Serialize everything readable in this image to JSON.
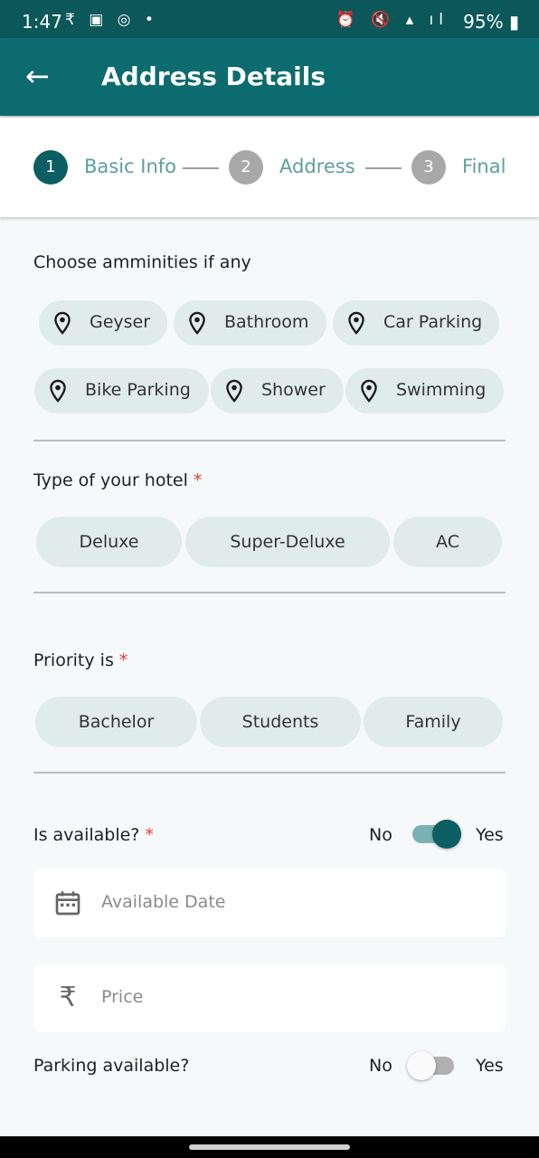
{
  "status_bar": {
    "time": "1:47",
    "left_icons": "₹ ▣ ◎ •",
    "right_icons": "⏰ 🔇 ▴ ıl",
    "battery": "95% ▮"
  },
  "app_bar": {
    "back_icon": "←",
    "title": "Address Details"
  },
  "stepper": {
    "steps": [
      {
        "number": "1",
        "label": "Basic Info",
        "state": "active"
      },
      {
        "number": "2",
        "label": "Address",
        "state": "inactive"
      },
      {
        "number": "3",
        "label": "Final",
        "state": "inactive"
      }
    ],
    "active_color": "#0b5e61",
    "inactive_color": "#a8a8a8",
    "label_color": "#5d9ea2"
  },
  "amenities": {
    "label": "Choose amminities if any",
    "chips": [
      "Geyser",
      "Bathroom",
      "Car Parking",
      "Bike Parking",
      "Shower",
      "Swimming"
    ],
    "chip_icon": "location-pin-icon"
  },
  "hotel_type": {
    "label": "Type of your hotel",
    "required": "*",
    "options": [
      "Deluxe",
      "Super-Deluxe",
      "AC"
    ]
  },
  "priority": {
    "label": "Priority is",
    "required": "*",
    "options": [
      "Bachelor",
      "Students",
      "Family"
    ]
  },
  "availability": {
    "label": "Is available?",
    "required": "*",
    "no_label": "No",
    "yes_label": "Yes",
    "toggle_on": true
  },
  "available_date": {
    "placeholder": "Available Date",
    "icon": "calendar-icon"
  },
  "price": {
    "placeholder": "Price",
    "icon": "rupee-icon",
    "icon_glyph": "₹"
  },
  "parking": {
    "label": "Parking available?",
    "no_label": "No",
    "yes_label": "Yes",
    "toggle_on": false
  },
  "colors": {
    "primary": "#0c6b6e",
    "status_bar": "#0b575a",
    "chip_bg": "#e0ecec",
    "required": "#e53935"
  }
}
